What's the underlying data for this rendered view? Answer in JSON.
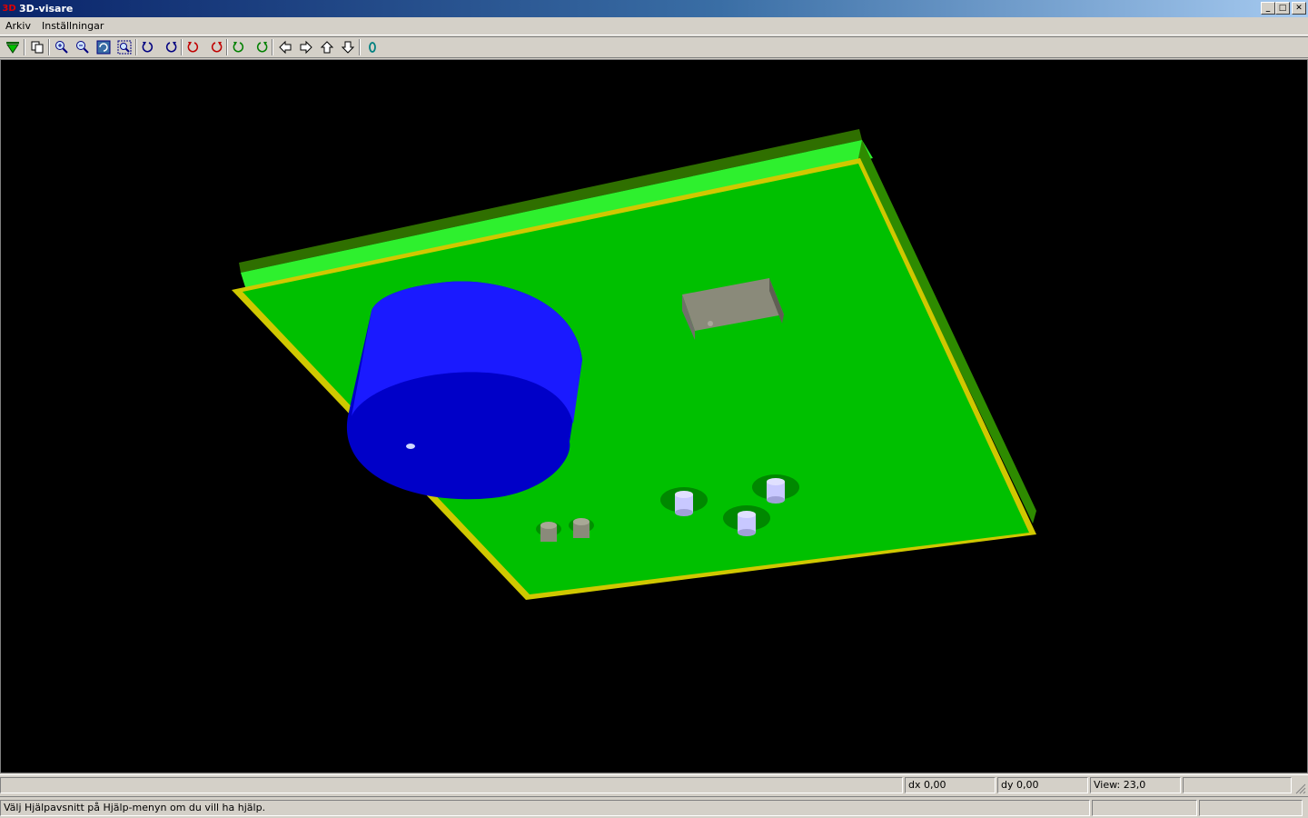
{
  "window": {
    "title": "3D-visare",
    "app_icon_text": "3D"
  },
  "menu": {
    "items": [
      "Arkiv",
      "Inställningar"
    ]
  },
  "status": {
    "dx": "dx 0,00",
    "dy": "dy 0,00",
    "view": "View: 23,0",
    "help": "Välj Hjälpavsnitt på Hjälp-menyn om du vill ha hjälp."
  },
  "colors": {
    "board_top": "#00c000",
    "board_edge": "#d0c800",
    "capacitor": "#0000e0",
    "viewport_bg": "#000000"
  },
  "toolbar_icons": [
    "green-down-arrow-icon",
    "copy-icon",
    "zoom-in-icon",
    "zoom-out-icon",
    "refresh-view-icon",
    "zoom-fit-icon",
    "rotate-left-x-icon",
    "rotate-right-x-icon",
    "rotate-left-y-icon",
    "rotate-right-y-icon",
    "rotate-left-z-icon",
    "rotate-right-z-icon",
    "pan-left-icon",
    "pan-right-icon",
    "pan-up-icon",
    "pan-down-icon",
    "reset-zero-icon"
  ]
}
